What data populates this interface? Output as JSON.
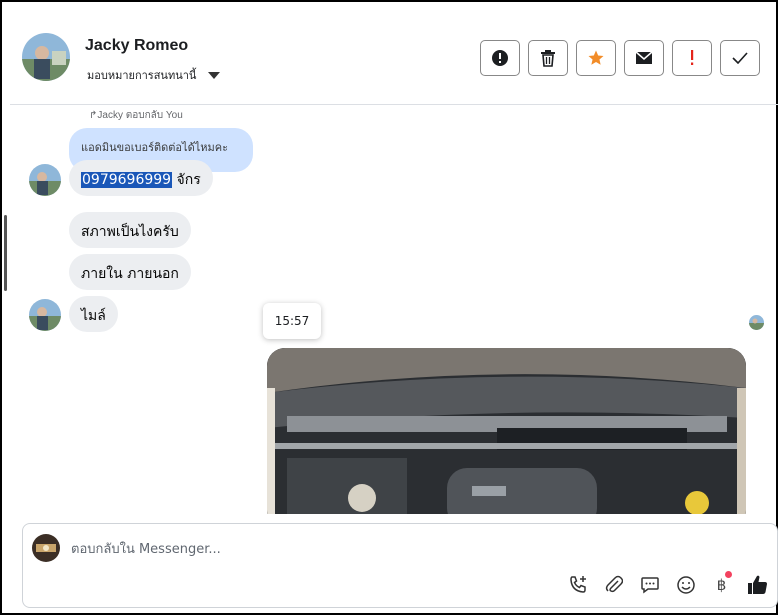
{
  "contact": {
    "name": "Jacky Romeo",
    "assign_label": "มอบหมายการสนทนานี้"
  },
  "header_actions": [
    {
      "name": "spam-button",
      "icon": "alert-circle-icon"
    },
    {
      "name": "delete-button",
      "icon": "trash-icon"
    },
    {
      "name": "star-button",
      "icon": "star-icon",
      "color": "#f28c28"
    },
    {
      "name": "mark-unread-button",
      "icon": "envelope-icon"
    },
    {
      "name": "follow-up-button",
      "icon": "exclamation-icon",
      "color": "#e4251b"
    },
    {
      "name": "mark-done-button",
      "icon": "check-icon"
    }
  ],
  "messages": {
    "reply_note": "Jacky ตอบกลับ You",
    "quoted_text": "แอดมินขอเบอร์ติดต่อได้ไหมคะ",
    "phone_highlight": "0979696999",
    "phone_suffix": " จักร",
    "msg2": "สภาพเป็นไงครับ",
    "msg3": "ภายใน ภายนอก",
    "msg4": "ไมล์",
    "timestamp": "15:57"
  },
  "composer": {
    "placeholder": "ตอบกลับใน Messenger...",
    "tools": [
      "phone-add-icon",
      "paperclip-icon",
      "comment-icon",
      "smile-icon",
      "baht-icon",
      "thumbs-up-icon"
    ],
    "baht_symbol": "฿"
  },
  "colors": {
    "quote_bubble": "#cfe2ff",
    "bubble": "#eceef1",
    "highlight": "#1a57b8",
    "star": "#f28c28",
    "alert": "#e4251b",
    "notification_dot": "#f3425f"
  }
}
